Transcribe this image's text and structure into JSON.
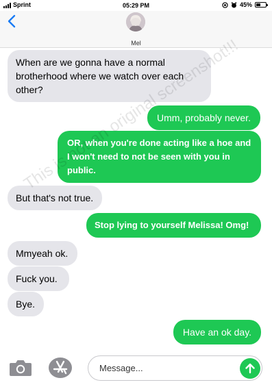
{
  "status_bar": {
    "carrier": "Sprint",
    "time": "05:29 PM",
    "battery": "45%"
  },
  "header": {
    "contact_name": "Mel"
  },
  "messages": [
    {
      "direction": "incoming",
      "text": "When are we gonna have a normal brotherhood where we watch over each other?"
    },
    {
      "direction": "outgoing",
      "text": "Umm, probably never."
    },
    {
      "direction": "outgoing",
      "text": "OR, when you're done acting like a hoe and I won't need to not be seen with you in public."
    },
    {
      "direction": "incoming",
      "text": "But that's not true."
    },
    {
      "direction": "outgoing",
      "text": "Stop lying to yourself Melissa! Omg!"
    },
    {
      "direction": "incoming",
      "text": "Mmyeah ok."
    },
    {
      "direction": "incoming",
      "text": "Fuck you."
    },
    {
      "direction": "incoming",
      "text": "Bye."
    },
    {
      "direction": "outgoing",
      "text": "Have an ok day."
    }
  ],
  "watermark": "This is not an original screenshot!!!",
  "input": {
    "placeholder": "Message..."
  },
  "colors": {
    "outgoing_bubble": "#1ec854",
    "incoming_bubble": "#e5e5ea",
    "accent_blue": "#1a7cf5"
  },
  "icons": {
    "back": "chevron-left-icon",
    "camera": "camera-icon",
    "appstore": "app-store-icon",
    "send": "arrow-up-icon"
  }
}
